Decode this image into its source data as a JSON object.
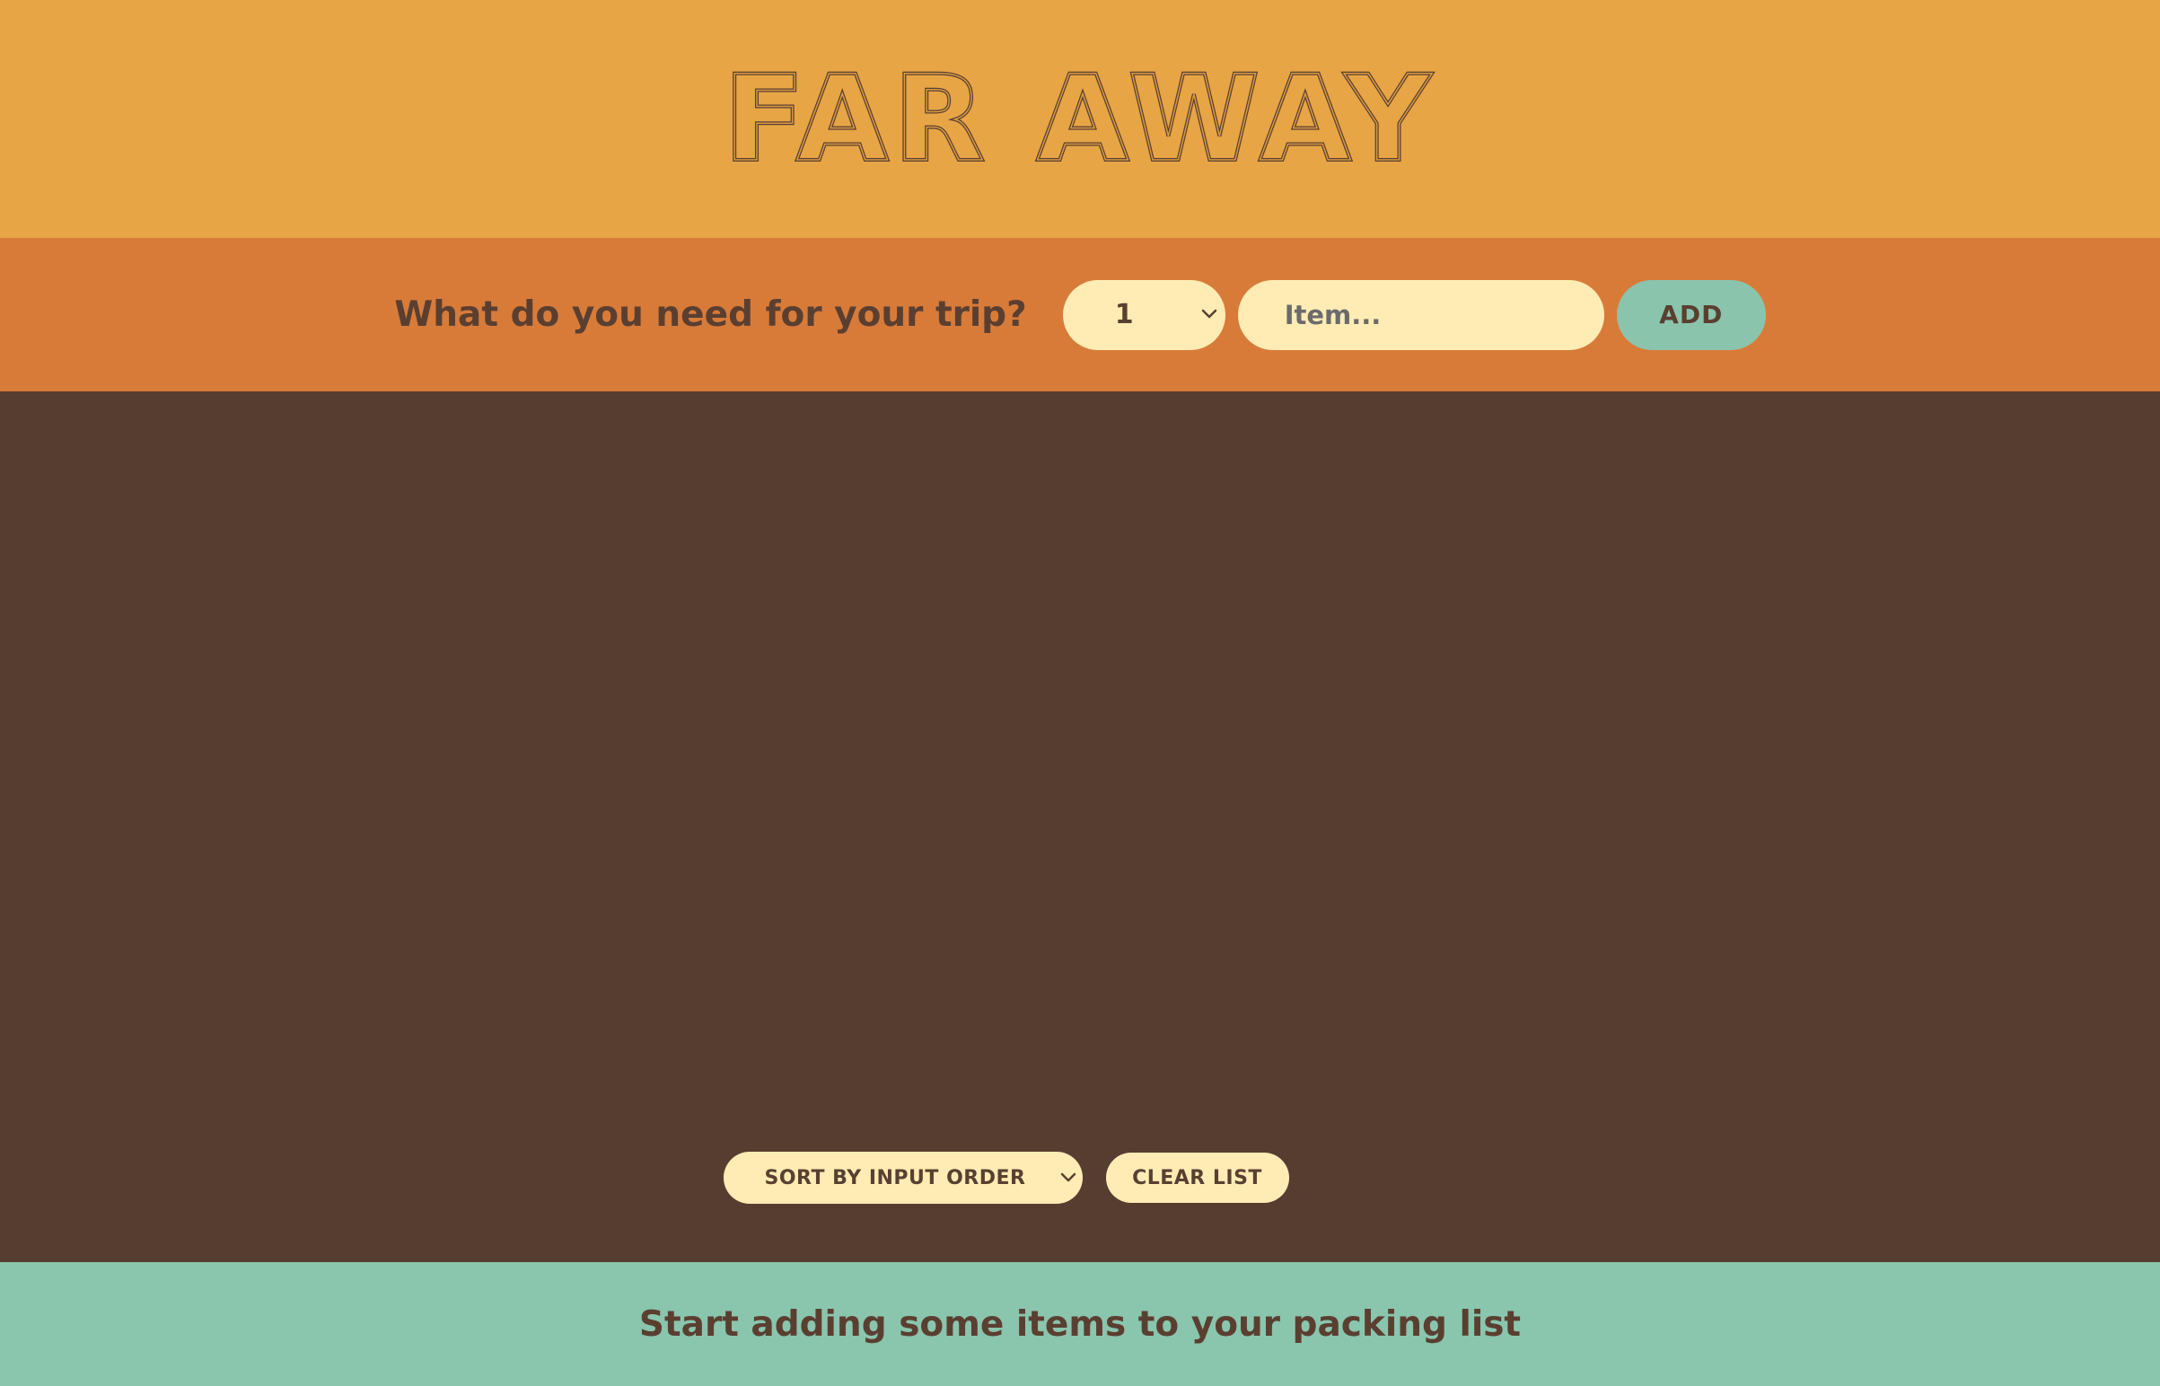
{
  "header": {
    "title": "FAR AWAY"
  },
  "form": {
    "question": "What do you need for your trip?",
    "quantity_value": "1",
    "item_placeholder": "Item...",
    "add_label": "ADD"
  },
  "actions": {
    "sort_label": "SORT BY INPUT ORDER",
    "clear_label": "CLEAR LIST"
  },
  "footer": {
    "stats": "Start adding some items to your packing list"
  },
  "colors": {
    "header_bg": "#e8a545",
    "form_bg": "#d87b39",
    "list_bg": "#573d30",
    "footer_bg": "#8ac5ae",
    "pill_bg": "#ffecb5",
    "text_brown": "#5a3f31"
  },
  "icons": {
    "quantity_select": "chevron-down-icon",
    "sort_select": "chevron-down-icon"
  }
}
